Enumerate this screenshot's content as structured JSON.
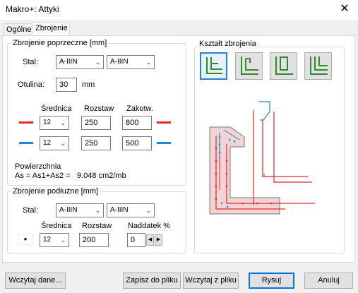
{
  "window": {
    "title": "Makro+: Attyki",
    "close_glyph": "✕"
  },
  "tabs": [
    {
      "label": "Ogólne"
    },
    {
      "label": "Zbrojenie"
    }
  ],
  "transverse": {
    "title": "Zbrojenie poprzeczne [mm]",
    "steel_label": "Stal:",
    "steel_1": "A-IIIN",
    "steel_2": "A-IIIN",
    "cover_label": "Otulina:",
    "cover_value": "30",
    "cover_unit": "mm",
    "headers": {
      "diameter": "Średnica",
      "spacing": "Rozstaw",
      "anchorage": "Zakotw."
    },
    "rows": [
      {
        "color": "#e8262b",
        "diameter": "12",
        "spacing": "250",
        "anchorage": "800"
      },
      {
        "color": "#1e88d6",
        "diameter": "12",
        "spacing": "250",
        "anchorage": "500"
      }
    ],
    "area_label": "Powierzchnia",
    "area_formula": "As = As1+As2 =",
    "area_value": "9.048 cm2/mb"
  },
  "longitudinal": {
    "title": "Zbrojenie podłużne [mm]",
    "steel_label": "Stal:",
    "steel_1": "A-IIIN",
    "steel_2": "A-IIIN",
    "headers": {
      "diameter": "Średnica",
      "spacing": "Rozstaw",
      "excess": "Naddatek %"
    },
    "marker": "•",
    "diameter": "12",
    "spacing": "200",
    "excess": "0"
  },
  "shape": {
    "title": "Kształt zbrojenia",
    "icon_color": "#2f8a2f"
  },
  "buttons": {
    "load_data": "Wczytaj dane...",
    "save_file": "Zapisz do pliku",
    "load_file": "Wczytaj z pliku",
    "draw": "Rysuj",
    "cancel": "Anuluj"
  }
}
